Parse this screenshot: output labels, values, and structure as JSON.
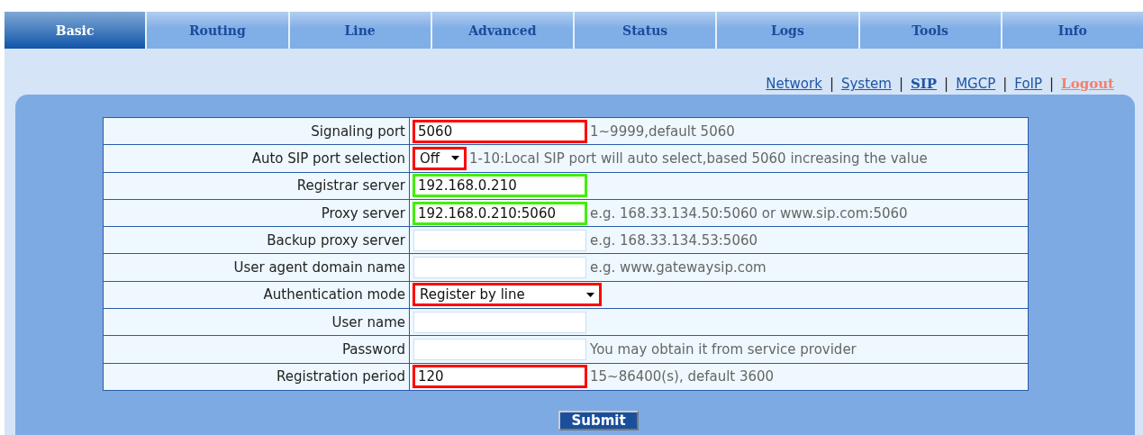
{
  "tabs": [
    {
      "label": "Basic",
      "selected": true
    },
    {
      "label": "Routing",
      "selected": false
    },
    {
      "label": "Line",
      "selected": false
    },
    {
      "label": "Advanced",
      "selected": false
    },
    {
      "label": "Status",
      "selected": false
    },
    {
      "label": "Logs",
      "selected": false
    },
    {
      "label": "Tools",
      "selected": false
    },
    {
      "label": "Info",
      "selected": false
    }
  ],
  "subnav": [
    {
      "kind": "link",
      "label": "Network",
      "selected": false
    },
    {
      "kind": "separator",
      "label": "|"
    },
    {
      "kind": "link",
      "label": "System",
      "selected": false
    },
    {
      "kind": "separator",
      "label": "|"
    },
    {
      "kind": "link",
      "label": "SIP",
      "selected": true
    },
    {
      "kind": "separator",
      "label": "|"
    },
    {
      "kind": "link",
      "label": "MGCP",
      "selected": false
    },
    {
      "kind": "separator",
      "label": "|"
    },
    {
      "kind": "link",
      "label": "FoIP",
      "selected": false
    },
    {
      "kind": "separator",
      "label": "|"
    },
    {
      "kind": "logout",
      "label": "Logout"
    }
  ],
  "form": {
    "rows": [
      {
        "label": "Signaling port",
        "kind": "input",
        "value": "5060",
        "hint": "1~9999,default 5060",
        "color": "#ff0000"
      },
      {
        "label": "Auto SIP port selection",
        "kind": "select",
        "value": "Off",
        "hint": "1-10:Local SIP port will auto select,based 5060 increasing the value",
        "color": "#ff0000"
      },
      {
        "label": "Registrar server",
        "kind": "input",
        "value": "192.168.0.210",
        "color": "#44ee00"
      },
      {
        "label": "Proxy server",
        "kind": "input",
        "value": "192.168.0.210:5060",
        "hint": "e.g. 168.33.134.50:5060 or www.sip.com:5060",
        "color": "#44ee00"
      },
      {
        "label": "Backup proxy server",
        "kind": "input",
        "hint": "e.g. 168.33.134.53:5060"
      },
      {
        "label": "User agent domain name",
        "kind": "input",
        "hint": "e.g. www.gatewaysip.com"
      },
      {
        "label": "Authentication mode",
        "kind": "select",
        "value": "Register by line",
        "color": "#ff0000"
      },
      {
        "label": "User name",
        "kind": "input"
      },
      {
        "label": "Password",
        "kind": "input",
        "hint": "You may obtain it from service provider"
      },
      {
        "label": "Registration period",
        "kind": "input",
        "value": "120",
        "hint": "15~86400(s), default 3600",
        "color": "#ff0000"
      }
    ],
    "submit": "Submit"
  }
}
